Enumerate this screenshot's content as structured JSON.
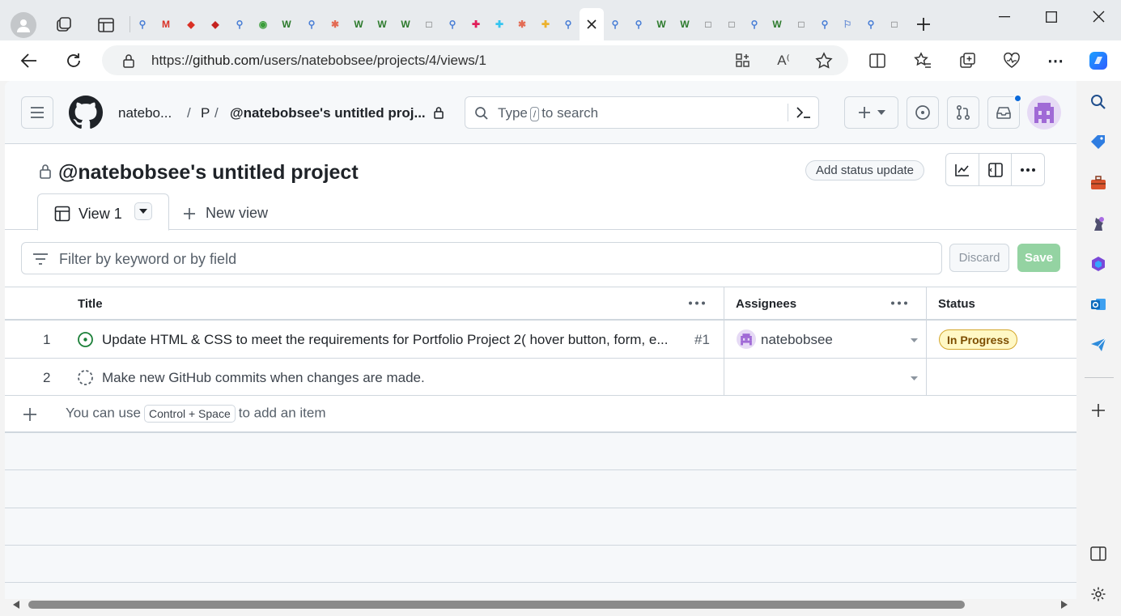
{
  "browser": {
    "url_prefix": "https://",
    "url_host": "github.com",
    "url_path": "/users/natebobsee/projects/4/views/1"
  },
  "header": {
    "owner_crumb": "natebo...",
    "projects_crumb": "P",
    "separator": "/",
    "project_crumb": "@natebobsee's untitled proj...",
    "search_prefix": "Type",
    "search_key": "/",
    "search_suffix": "to search"
  },
  "project": {
    "title": "@natebobsee's untitled project",
    "status_update_label": "Add status update"
  },
  "tabs": {
    "view1_label": "View 1",
    "new_view_label": "New view"
  },
  "filter": {
    "placeholder": "Filter by keyword or by field",
    "discard_label": "Discard",
    "save_label": "Save"
  },
  "table": {
    "columns": {
      "title": "Title",
      "assignees": "Assignees",
      "status": "Status"
    },
    "rows": [
      {
        "num": "1",
        "title": "Update HTML & CSS to meet the requirements for Portfolio Project 2( hover button, form, e...",
        "issue": "#1",
        "assignee": "natebobsee",
        "status": "In Progress"
      },
      {
        "num": "2",
        "title": "Make new GitHub commits when changes are made.",
        "issue": "",
        "assignee": "",
        "status": ""
      }
    ],
    "add_hint_prefix": "You can use",
    "add_hint_key": "Control + Space",
    "add_hint_suffix": "to add an item"
  },
  "colors": {
    "accent_green": "#1a7f37",
    "status_bg": "#fff8c5",
    "save_bg": "#94d3a2"
  }
}
